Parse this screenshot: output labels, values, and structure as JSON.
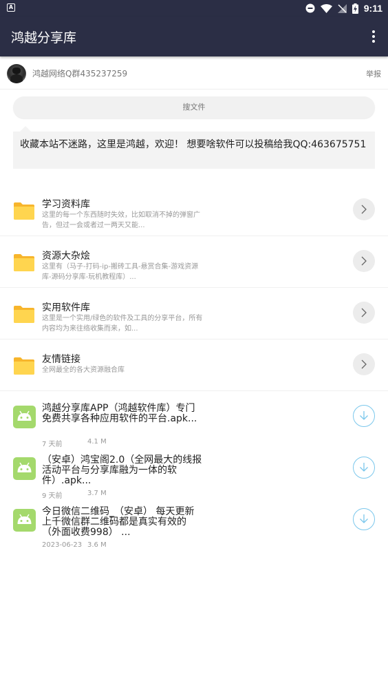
{
  "status_bar": {
    "time": "9:11",
    "icons": [
      "notification-a-icon",
      "do-not-disturb-icon",
      "wifi-icon",
      "no-signal-icon",
      "battery-charging-icon"
    ]
  },
  "app_bar": {
    "title": "鸿越分享库",
    "menu_icon": "more-vert-icon"
  },
  "owner": {
    "name": "鸿越网络Q群435237259",
    "report_label": "举报"
  },
  "search": {
    "placeholder": "搜文件"
  },
  "notice": {
    "text": "收藏本站不迷路，这里是鸿越，欢迎！ 想要啥软件可以投稿给我QQ:463675751"
  },
  "folders": [
    {
      "title": "学习资料库",
      "desc": "这里的每一个东西随时失效，比如取消不掉的弹窗广告，但过一会或者过一两天又能..."
    },
    {
      "title": "资源大杂烩",
      "desc": "这里有（马子-打码-ip-搬砖工具-悬赏合集-游戏资源库-源码分享库-玩机教程库）..."
    },
    {
      "title": "实用软件库",
      "desc": "这里是一个实用/绿色的软件及工具的分享平台，所有内容均为来往络收集而来，如..."
    },
    {
      "title": "友情链接",
      "desc": "全网最全的各大资源融合库"
    }
  ],
  "files": [
    {
      "name": "鸿越分享库APP（鸿越软件库）专门免费共享各种应用软件的平台.apk...",
      "date": "7 天前",
      "size": "4.1 M"
    },
    {
      "name": "（安卓）鸿宝阁2.0（全网最大的线报活动平台与分享库融为一体的软件）.apk...",
      "date": "9 天前",
      "size": "3.7 M"
    },
    {
      "name": "今日微信二维码_（安卓） 每天更新上千微信群二维码都是真实有效的（外面收费998） ...",
      "date": "2023-06-23",
      "size": "3.6 M"
    }
  ],
  "colors": {
    "app_bar": "#2b2e45",
    "folder": "#ffd54f",
    "android": "#a4d96c",
    "download_accent": "#7ac7ec"
  }
}
